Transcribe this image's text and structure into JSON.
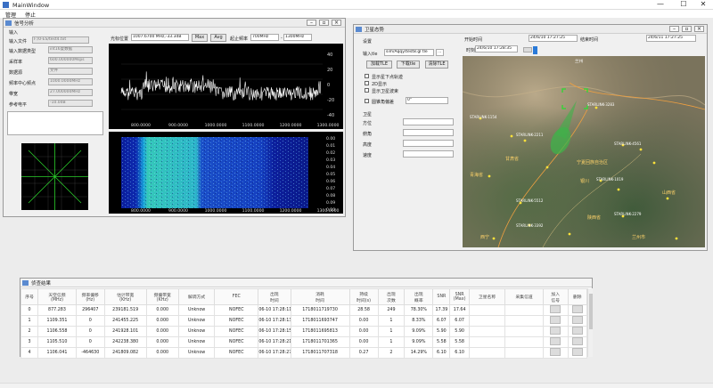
{
  "window": {
    "title": "MainWindow",
    "min": "—",
    "max": "☐",
    "close": "✕"
  },
  "menu": [
    "管理",
    "停止"
  ],
  "signal": {
    "title": "信号分析",
    "input_group": "输入",
    "input_file_label": "输入文件",
    "input_file_value": "F:/0-ES/test4.txt",
    "input_type_label": "输入数据类型",
    "input_type_value": "int16复数据",
    "sample_rate_label": "采样率",
    "sample_rate_value": "600.000000Msps",
    "datasource_label": "数据源",
    "datasource_value": "文件",
    "center_freq_label": "频率中心频点",
    "center_freq_value": "1000.0000MHz",
    "bandwidth_label": "带宽",
    "bandwidth_value": "27.000000MHz",
    "ref_level_label": "参考电平",
    "ref_level_value": "-10.0dB",
    "cursor_label": "光标位置",
    "cursor_value": "1007.6700 MHz,-33.3dB",
    "max_btn": "Max",
    "avg_btn": "Avg",
    "range_label": "起止频率",
    "range_start": "700MHz",
    "range_end": "1300MHz",
    "yticks": [
      "40",
      "20",
      "0",
      "-20",
      "-40"
    ],
    "xticks": [
      "800.0000",
      "900.0000",
      "1000.0000",
      "1100.0000",
      "1200.0000",
      "1300.0000"
    ],
    "wf_yticks": [
      "0.00",
      "0.01",
      "0.02",
      "0.03",
      "0.04",
      "0.05",
      "0.06",
      "0.07",
      "0.08",
      "0.09",
      "0.10"
    ],
    "wf_xticks": [
      "800.0000",
      "900.0000",
      "1000.0000",
      "1100.0000",
      "1200.0000",
      "1300.0000"
    ]
  },
  "satellite": {
    "title": "卫星态势",
    "settings_group": "设置",
    "input_tle_label": "输入tle",
    "input_tle_value": "sim/Aqqy/test8.gl tle",
    "load_tle": "加载TLE",
    "download_tle": "下载tle",
    "clear_tle": "清除TLE",
    "cb1": "显示星下点轨迹",
    "cb2": "2D显示",
    "cb3": "显示卫星波束",
    "cb4": "圆锥角偏差",
    "cone_value": "0°",
    "sat_group": "卫星",
    "azimuth": "方位",
    "pitch": "俯角",
    "altitude": "高度",
    "speed": "速度",
    "start_time_label": "开始时间",
    "start_time": "24/6/10 17:27:25",
    "end_time_label": "结束时间",
    "end_time": "24/6/11 17:27:25",
    "time_label": "时刻",
    "time_value": "24/6/10 17:28:35",
    "map_labels": [
      "兰州",
      "STARLINK-3283",
      "STARLINK-1154",
      "STARLINK-2211",
      "STARLINK-4561",
      "STARLINK-1019",
      "STARLINK-5512",
      "STARLINK-2279",
      "STARLINK-3392",
      "宁夏回族自治区",
      "甘肃省",
      "银川",
      "陕西省",
      "山西省",
      "青海省",
      "西宁",
      "兰州市"
    ]
  },
  "results": {
    "title": "侦查结果",
    "headers": [
      "序号",
      "天空信频\n(MHz)",
      "频率偏移\n(Hz)",
      "估计带宽\n(KHz)",
      "频偏带宽\n(KHz)",
      "解调方式",
      "FEC",
      "出现\n时间",
      "消耗\n时间",
      "持续\n时间(s)",
      "出现\n次数",
      "出现\n概率",
      "SNR",
      "SNR\n(Max)",
      "卫星名称",
      "采集信道",
      "加入\n信号",
      "删除"
    ],
    "rows": [
      [
        "0",
        "877.283",
        "296407",
        "239181.519",
        "0.000",
        "Unknow",
        "NOFEC",
        "06-10 17:28:11",
        "1718011719730",
        "28.58",
        "249",
        "78.30%",
        "17.39",
        "17.64",
        "",
        "",
        "",
        ""
      ],
      [
        "1",
        "1109.351",
        "0",
        "241455.225",
        "0.000",
        "Unknow",
        "NOFEC",
        "06-10 17:28:13",
        "1718011693747",
        "0.00",
        "1",
        "8.33%",
        "6.07",
        "6.07",
        "",
        "",
        "",
        ""
      ],
      [
        "2",
        "1106.558",
        "0",
        "241928.101",
        "0.000",
        "Unknow",
        "NOFEC",
        "06-10 17:28:15",
        "1718011695813",
        "0.00",
        "1",
        "9.09%",
        "5.90",
        "5.90",
        "",
        "",
        "",
        ""
      ],
      [
        "3",
        "1105.510",
        "0",
        "242238.380",
        "0.000",
        "Unknow",
        "NOFEC",
        "06-10 17:28:21",
        "1718011701365",
        "0.00",
        "1",
        "9.09%",
        "5.58",
        "5.58",
        "",
        "",
        "",
        ""
      ],
      [
        "4",
        "1106.041",
        "-464630",
        "241809.082",
        "0.000",
        "Unknow",
        "NOFEC",
        "06-10 17:28:27",
        "1718011707318",
        "0.27",
        "2",
        "14.29%",
        "6.10",
        "6.10",
        "",
        "",
        "",
        ""
      ]
    ]
  },
  "colors": {
    "plot_bg": "#000000",
    "waterfall_bg": "#0a1a8a",
    "accent": "#2a7ad8"
  }
}
